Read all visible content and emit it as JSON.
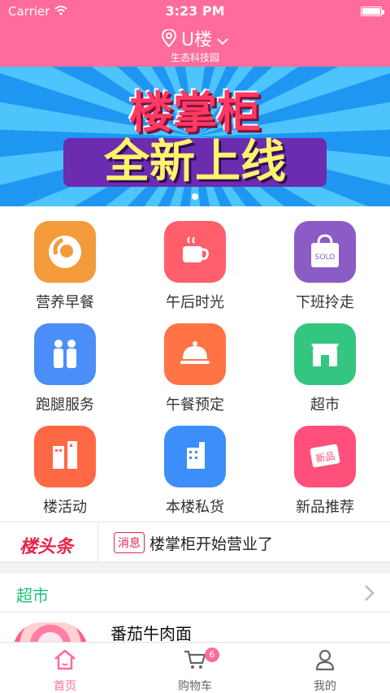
{
  "status": {
    "carrier": "Carrier",
    "time": "3:23 PM"
  },
  "header": {
    "location": "U楼",
    "sub_location": "生态科技园"
  },
  "banner": {
    "title_top": "楼掌柜",
    "title_bottom": "全新上线"
  },
  "menu": [
    {
      "label": "营养早餐",
      "icon": "breakfast-icon",
      "color": "#f39b3a"
    },
    {
      "label": "午后时光",
      "icon": "coffee-icon",
      "color": "#ff5f6d"
    },
    {
      "label": "下班拎走",
      "icon": "shopping-bag-icon",
      "color": "#8b5cc6"
    },
    {
      "label": "跑腿服务",
      "icon": "people-icon",
      "color": "#4c8ef7"
    },
    {
      "label": "午餐预定",
      "icon": "cloche-icon",
      "color": "#ff7344"
    },
    {
      "label": "超市",
      "icon": "store-icon",
      "color": "#34c680"
    },
    {
      "label": "楼活动",
      "icon": "buildings-icon",
      "color": "#ff6844"
    },
    {
      "label": "本楼私货",
      "icon": "tower-icon",
      "color": "#3c8ef8"
    },
    {
      "label": "新品推荐",
      "icon": "new-tag-icon",
      "color": "#ff4f7a"
    }
  ],
  "news": {
    "logo": "楼头条",
    "tag": "消息",
    "text": "楼掌柜开始营业了"
  },
  "section": {
    "title": "超市"
  },
  "product": {
    "name": "番茄牛肉面"
  },
  "tabs": [
    {
      "label": "首页",
      "icon": "home-icon"
    },
    {
      "label": "购物车",
      "icon": "cart-icon",
      "badge": "6"
    },
    {
      "label": "我的",
      "icon": "user-icon"
    }
  ],
  "colors": {
    "accent": "#ff6b9a",
    "section_green": "#20c27a",
    "news_red": "#e7254b"
  }
}
